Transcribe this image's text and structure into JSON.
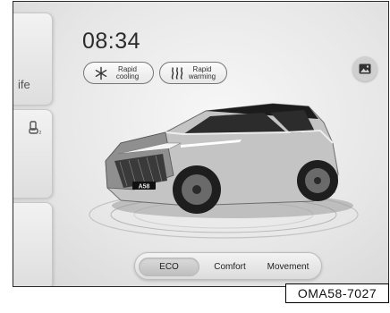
{
  "status": {
    "time": "08:34"
  },
  "sidebar": {
    "card_1_label": "ife",
    "card_2_icon": "seat-icon"
  },
  "climate": {
    "rapid_cooling": {
      "line1": "Rapid",
      "line2": "cooling",
      "icon": "snowflake-icon"
    },
    "rapid_warming": {
      "line1": "Rapid",
      "line2": "warming",
      "icon": "heat-icon"
    }
  },
  "gallery_icon": "image-icon",
  "car": {
    "badge": "A58"
  },
  "modes": {
    "items": [
      "ECO",
      "Comfort",
      "Movement"
    ],
    "selected": "ECO"
  },
  "reference": "OMA58-7027"
}
